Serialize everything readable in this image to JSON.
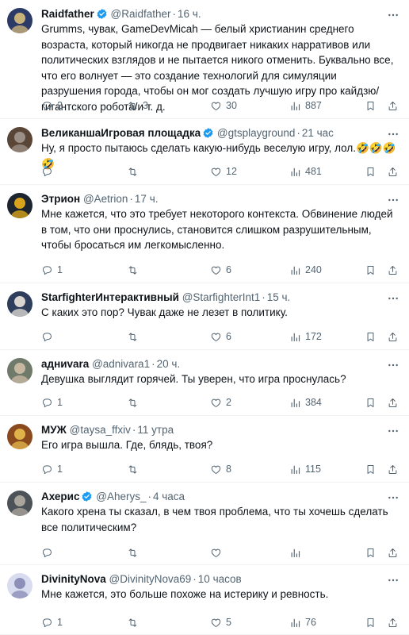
{
  "tweets": [
    {
      "name": "Raidfather",
      "verified": true,
      "handle": "@Raidfather",
      "time": "16 ч.",
      "text": "Grumms, чувак, GameDevMicah — белый христианин среднего возраста, который никогда не продвигает никаких нарративов или политических взглядов и не пытается никого отменить. Буквально все, что его волнует — это создание технологий для симуляции разрушения города, чтобы он мог создать лучшую игру про кайдзю/гигантского робота/и т. д.",
      "replies": "2",
      "retweets": "3",
      "likes": "30",
      "views": "887",
      "avatar_colors": [
        "#2b3a67",
        "#c9b27a"
      ]
    },
    {
      "name": "ВеликаншаИгровая площадка",
      "verified": true,
      "handle": "@gtsplayground",
      "time": "21 час",
      "text": "Ну, я просто пытаюсь сделать какую-нибудь веселую игру, лол.🤣🤣🤣🤣",
      "replies": "",
      "retweets": "",
      "likes": "12",
      "views": "481",
      "avatar_colors": [
        "#5a4636",
        "#9b8f86"
      ]
    },
    {
      "name": "Этрион",
      "verified": false,
      "handle": "@Aetrion",
      "time": "17 ч.",
      "text": "Мне кажется, что это требует некоторого контекста. Обвинение людей в том, что они проснулись, становится слишком разрушительным, чтобы бросаться им легкомысленно.",
      "replies": "1",
      "retweets": "",
      "likes": "6",
      "views": "240",
      "avatar_colors": [
        "#1c2430",
        "#d8a21a"
      ]
    },
    {
      "name": "StarfighterИнтерактивный",
      "verified": false,
      "handle": "@StarfighterInt1",
      "time": "15 ч.",
      "text": "С каких это пор? Чувак даже не лезет в политику.",
      "replies": "",
      "retweets": "",
      "likes": "6",
      "views": "172",
      "avatar_colors": [
        "#2e3d5c",
        "#d9d4cf"
      ]
    },
    {
      "name": "адниvara",
      "verified": false,
      "handle": "@adnivara1",
      "time": "20 ч.",
      "text": "Девушка выглядит горячей. Ты уверен, что игра проснулась?",
      "replies": "1",
      "retweets": "",
      "likes": "2",
      "views": "384",
      "avatar_colors": [
        "#6f7a6a",
        "#c6b7a1"
      ]
    },
    {
      "name": "МУЖ",
      "verified": false,
      "handle": "@taysa_ffxiv",
      "time": "11 утра",
      "text": "Его игра вышла. Где, блядь, твоя?",
      "replies": "1",
      "retweets": "",
      "likes": "8",
      "views": "115",
      "avatar_colors": [
        "#8a4a1e",
        "#e0b24a"
      ]
    },
    {
      "name": "Ахерис",
      "verified": true,
      "handle": "@Aherys_",
      "time": "4 часа",
      "text": "Какого хрена ты сказал, в чем твоя проблема, что ты хочешь сделать все политическим?",
      "replies": "",
      "retweets": "",
      "likes": "",
      "views": "",
      "avatar_colors": [
        "#4b5258",
        "#a9a49c"
      ]
    },
    {
      "name": "DivinityNova",
      "verified": false,
      "handle": "@DivinityNova69",
      "time": "10 часов",
      "text": "Мне кажется, это больше похоже на истерику и ревность.",
      "replies": "1",
      "retweets": "",
      "likes": "5",
      "views": "76",
      "avatar_colors": [
        "#d9dcef",
        "#8d8fb8"
      ]
    }
  ],
  "colors": {
    "text": "#0f1419",
    "secondary": "#536471",
    "verified": "#1d9bf0",
    "divider": "#eff3f4"
  },
  "icons": [
    "reply-icon",
    "retweet-icon",
    "like-icon",
    "views-icon",
    "bookmark-icon",
    "share-icon",
    "more-icon",
    "verified-badge-icon"
  ]
}
